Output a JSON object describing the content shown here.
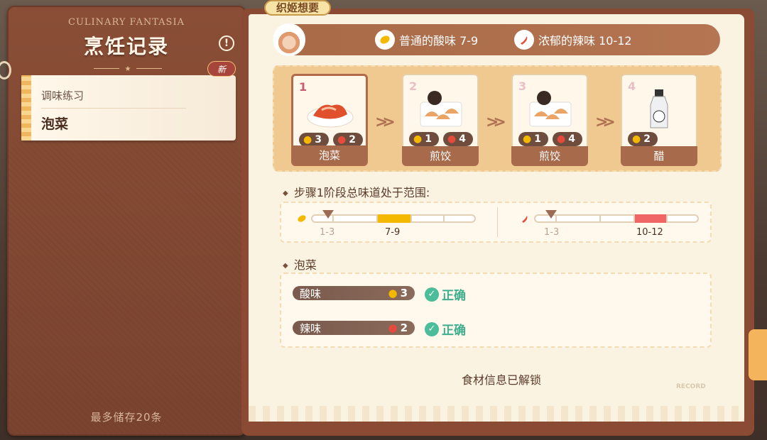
{
  "sidebar": {
    "brand": "CULINARY FANTASIA",
    "title": "烹饪记录",
    "entry": {
      "subtitle": "调味练习",
      "name": "泡菜",
      "badge": "新"
    },
    "footer": "最多储存20条"
  },
  "character": {
    "name": "织姬想要"
  },
  "wants": [
    {
      "label": "普通的酸味 7-9",
      "icon": "lemon-icon"
    },
    {
      "label": "浓郁的辣味 10-12",
      "icon": "chili-icon"
    }
  ],
  "steps": [
    {
      "num": "1",
      "name": "泡菜",
      "sour": "3",
      "spicy": "2"
    },
    {
      "num": "2",
      "name": "煎饺",
      "sour": "1",
      "spicy": "4"
    },
    {
      "num": "3",
      "name": "煎饺",
      "sour": "1",
      "spicy": "4"
    },
    {
      "num": "4",
      "name": "醋",
      "sour": "2"
    }
  ],
  "range": {
    "title": "步骤1阶段总味道处于范围:",
    "sour": {
      "current": "1-3",
      "target": "7-9",
      "color": "#f5b800"
    },
    "spicy": {
      "current": "1-3",
      "target": "10-12",
      "color": "#f06565"
    }
  },
  "detail": {
    "title": "泡菜",
    "rows": [
      {
        "label": "酸味",
        "value": "3",
        "status": "正确"
      },
      {
        "label": "辣味",
        "value": "2",
        "status": "正确"
      }
    ]
  },
  "unlock_text": "食材信息已解锁",
  "record_mark": "RECORD"
}
